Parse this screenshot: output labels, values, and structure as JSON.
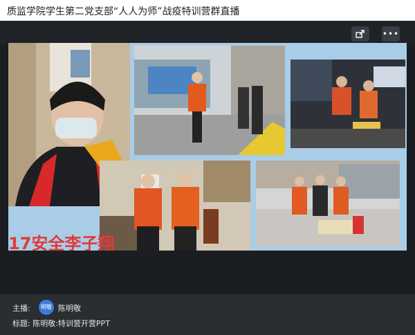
{
  "window": {
    "title": "质监学院学生第二党支部“人人为师”战疫特训营群直播"
  },
  "toolbar": {
    "share_icon": "share-icon",
    "more_icon": "more-icon"
  },
  "slide": {
    "caption": "17安全李子翔"
  },
  "footer": {
    "host_label": "主播:",
    "avatar_text": "明敬",
    "host_name": "陈明敬",
    "title_label": "标题:",
    "title_value": "陈明敬:特训营开营PPT"
  }
}
